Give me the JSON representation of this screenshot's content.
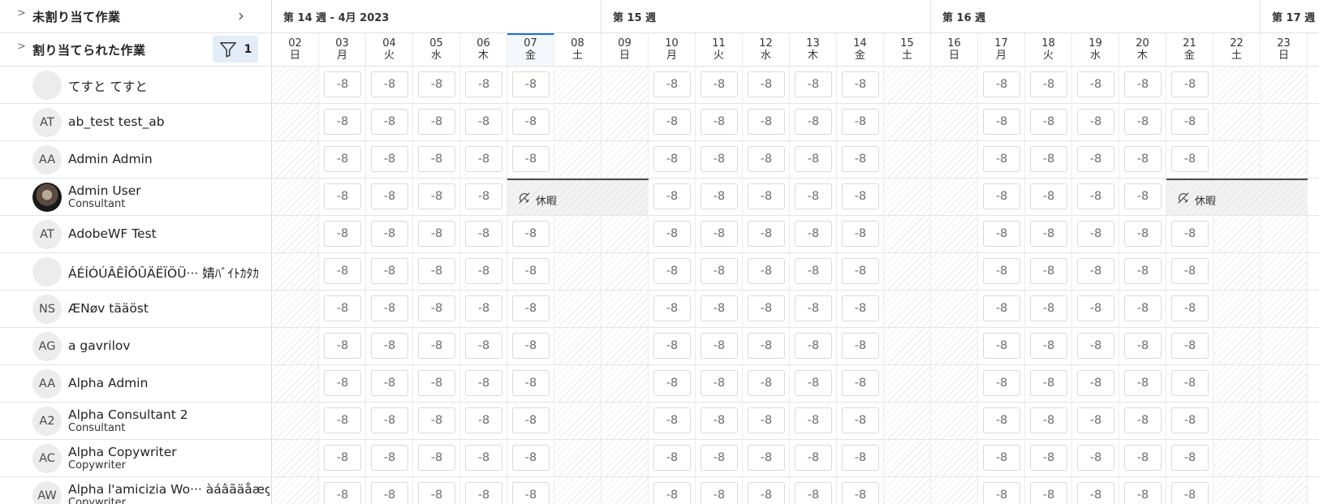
{
  "header": {
    "unassigned_title": "未割り当て作業",
    "assigned_title": "割り当てられた作業",
    "filter_count": "1"
  },
  "weeks": [
    {
      "label": "第 14 週 - 4月 2023"
    },
    {
      "label": "第 15 週"
    },
    {
      "label": "第 16 週"
    },
    {
      "label": "第 17 週"
    }
  ],
  "days": [
    {
      "num": "02",
      "dow": "日",
      "weekend": true
    },
    {
      "num": "03",
      "dow": "月",
      "weekend": false
    },
    {
      "num": "04",
      "dow": "火",
      "weekend": false
    },
    {
      "num": "05",
      "dow": "水",
      "weekend": false
    },
    {
      "num": "06",
      "dow": "木",
      "weekend": false
    },
    {
      "num": "07",
      "dow": "金",
      "weekend": false,
      "today": true
    },
    {
      "num": "08",
      "dow": "土",
      "weekend": true
    },
    {
      "num": "09",
      "dow": "日",
      "weekend": true
    },
    {
      "num": "10",
      "dow": "月",
      "weekend": false
    },
    {
      "num": "11",
      "dow": "火",
      "weekend": false
    },
    {
      "num": "12",
      "dow": "水",
      "weekend": false
    },
    {
      "num": "13",
      "dow": "木",
      "weekend": false
    },
    {
      "num": "14",
      "dow": "金",
      "weekend": false
    },
    {
      "num": "15",
      "dow": "土",
      "weekend": true
    },
    {
      "num": "16",
      "dow": "日",
      "weekend": true
    },
    {
      "num": "17",
      "dow": "月",
      "weekend": false
    },
    {
      "num": "18",
      "dow": "火",
      "weekend": false
    },
    {
      "num": "19",
      "dow": "水",
      "weekend": false
    },
    {
      "num": "20",
      "dow": "木",
      "weekend": false
    },
    {
      "num": "21",
      "dow": "金",
      "weekend": false
    },
    {
      "num": "22",
      "dow": "土",
      "weekend": true
    },
    {
      "num": "23",
      "dow": "日",
      "weekend": true
    }
  ],
  "availability_value": "-8",
  "time_off_label": "休暇",
  "people": [
    {
      "name": "てすと てすと",
      "initials": "",
      "role": ""
    },
    {
      "name": "ab_test test_ab",
      "initials": "AT",
      "role": ""
    },
    {
      "name": "Admin Admin",
      "initials": "AA",
      "role": ""
    },
    {
      "name": "Admin User",
      "initials": "",
      "role": "Consultant",
      "photo": true,
      "time_off_days": [
        5,
        6,
        7,
        19,
        20,
        21
      ]
    },
    {
      "name": "AdobeWF Test",
      "initials": "AT",
      "role": ""
    },
    {
      "name": "ÁÉÍÓÚÂÊÎÔÛÄËÏÖÜ··· 婧ﾊﾞｲﾄｶﾀｶ",
      "initials": "",
      "role": ""
    },
    {
      "name": "ÆNøv tääöst",
      "initials": "NS",
      "role": ""
    },
    {
      "name": "a gavrilov",
      "initials": "AG",
      "role": ""
    },
    {
      "name": "Alpha Admin",
      "initials": "AA",
      "role": ""
    },
    {
      "name": "Alpha Consultant 2",
      "initials": "A2",
      "role": "Consultant"
    },
    {
      "name": "Alpha Copywriter",
      "initials": "AC",
      "role": "Copywriter"
    },
    {
      "name": "Alpha l'amicizia Wo··· àáâãäåæç",
      "initials": "AW",
      "role": "Copywriter"
    }
  ],
  "colors": {
    "accent": "#1473e6",
    "filter_bg": "#e3edf8"
  }
}
